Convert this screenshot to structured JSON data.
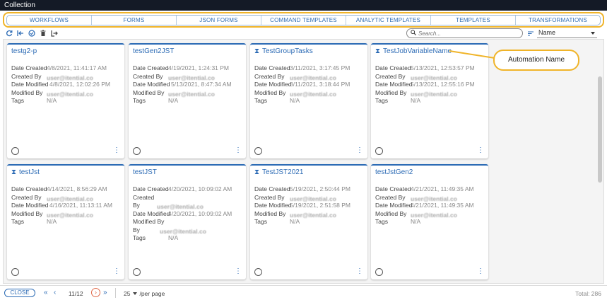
{
  "window": {
    "title": "Collection"
  },
  "tabs": [
    "WORKFLOWS",
    "FORMS",
    "JSON FORMS",
    "COMMAND TEMPLATES",
    "ANALYTIC TEMPLATES",
    "TEMPLATES",
    "TRANSFORMATIONS"
  ],
  "toolbar": {
    "icons": [
      "refresh-icon",
      "import-icon",
      "check-circle-icon",
      "trash-icon",
      "export-icon"
    ]
  },
  "search": {
    "placeholder": "Search..."
  },
  "sort": {
    "selected": "Name"
  },
  "labels": {
    "date_created": "Date Created",
    "created_by": "Created By",
    "date_modified": "Date Modified",
    "modified_by": "Modified By",
    "tags": "Tags",
    "created": "Created",
    "by": "By"
  },
  "cards": [
    {
      "title": "testg2-p",
      "icon": "",
      "date_created": "4/8/2021, 11:41:17 AM",
      "created_by": "user@itential.co",
      "date_modified": "4/8/2021, 12:02:26 PM",
      "modified_by": "user@itential.co",
      "tags": "N/A"
    },
    {
      "title": "testGen2JST",
      "icon": "",
      "date_created": "4/19/2021, 1:24:31 PM",
      "created_by": "user@itential.co",
      "date_modified": "5/13/2021, 8:47:34 AM",
      "modified_by": "user@itential.co",
      "tags": "N/A"
    },
    {
      "title": "TestGroupTasks",
      "icon": "hourglass-icon",
      "date_created": "3/11/2021, 3:17:45 PM",
      "created_by": "user@itential.co",
      "date_modified": "3/11/2021, 3:18:44 PM",
      "modified_by": "user@itential.co",
      "tags": "N/A"
    },
    {
      "title": "TestJobVariableName",
      "icon": "hourglass-icon",
      "date_created": "5/13/2021, 12:53:57 PM",
      "created_by": "user@itential.co",
      "date_modified": "5/13/2021, 12:55:16 PM",
      "modified_by": "user@itential.co",
      "tags": "N/A"
    },
    {
      "title": "testJst",
      "icon": "hourglass-icon",
      "date_created": "4/14/2021, 8:56:29 AM",
      "created_by": "user@itential.co",
      "date_modified": "4/16/2021, 11:13:11 AM",
      "modified_by": "user@itential.co",
      "tags": "N/A"
    },
    {
      "title": "testJST",
      "icon": "",
      "date_created": "4/20/2021, 10:09:02 AM",
      "created_by": "user@itential.co",
      "date_modified": "4/20/2021, 10:09:02 AM",
      "modified_by": "user@itential.co",
      "tags": "N/A"
    },
    {
      "title": "TestJST2021",
      "icon": "hourglass-icon",
      "date_created": "5/19/2021, 2:50:44 PM",
      "created_by": "user@itential.co",
      "date_modified": "5/19/2021, 2:51:58 PM",
      "modified_by": "user@itential.co",
      "tags": "N/A"
    },
    {
      "title": "testJstGen2",
      "icon": "",
      "date_created": "4/21/2021, 11:49:35 AM",
      "created_by": "user@itential.co",
      "date_modified": "4/21/2021, 11:49:35 AM",
      "modified_by": "user@itential.co",
      "tags": "N/A"
    }
  ],
  "callout": {
    "text": "Automation Name"
  },
  "footer": {
    "close_label": "CLOSE",
    "page": "11/12",
    "per_page": "25",
    "per_page_label": "/per page",
    "total": "Total: 286"
  },
  "colors": {
    "accent": "#2c6bb5",
    "highlight": "#f0b429",
    "titlebar": "#141a26",
    "next_ring": "#e06a4a"
  }
}
